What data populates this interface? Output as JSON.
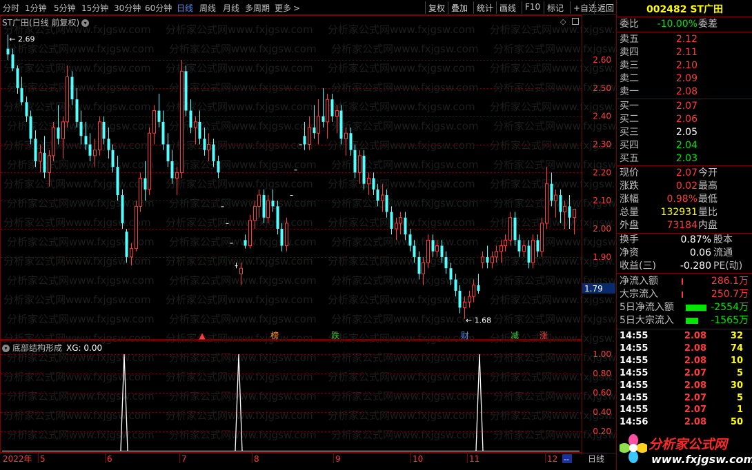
{
  "toolbar": {
    "periods": [
      "分时",
      "1分钟",
      "5分钟",
      "15分钟",
      "30分钟",
      "60分钟",
      "日线",
      "周线",
      "月线",
      "多周期",
      "更多"
    ],
    "active_period": "日线",
    "more_arrow": ">",
    "buttons": [
      "复权",
      "叠加",
      "统计",
      "画线",
      "F10",
      "标记",
      "+自选",
      "返回"
    ]
  },
  "main_chart": {
    "title": "ST广田(日线 前复权)",
    "max_label": "2.69",
    "min_label": "1.68",
    "current_price_tag": "1.79",
    "price_axis": [
      "2.60",
      "2.50",
      "2.40",
      "2.30",
      "2.20",
      "2.10",
      "2.00",
      "1.90"
    ],
    "markers": [
      {
        "label": "▲",
        "color": "#ff3b3b"
      },
      {
        "label": "榜",
        "color": "#ff9933"
      },
      {
        "label": "跌",
        "color": "#33cc33"
      },
      {
        "label": "财",
        "color": "#4f8ff7"
      },
      {
        "label": "减",
        "color": "#33cc33"
      },
      {
        "label": "涨",
        "color": "#ff3b3b"
      }
    ]
  },
  "sub_chart": {
    "title": "底部结构形成",
    "xg_label": "XG: 0.00",
    "axis": [
      "1.00",
      "0.80",
      "0.60",
      "0.40",
      "0.20"
    ],
    "signals": [
      1,
      1,
      1
    ]
  },
  "timeline": {
    "year": "2022年",
    "months": [
      "5",
      "6",
      "7",
      "8",
      "9",
      "10",
      "11",
      "12"
    ],
    "end_marker": "--",
    "period_label": "日线"
  },
  "watermark": "分析家公式网www.fxjgsw.com",
  "quote": {
    "code": "002482",
    "name": "ST广田",
    "weibi_label": "委比",
    "weibi_value": "-10.00%",
    "weicha_label": "委差",
    "asks": [
      {
        "label": "卖五",
        "price": "2.12"
      },
      {
        "label": "卖四",
        "price": "2.11"
      },
      {
        "label": "卖三",
        "price": "2.10"
      },
      {
        "label": "卖二",
        "price": "2.09"
      },
      {
        "label": "卖一",
        "price": "2.08"
      }
    ],
    "bids": [
      {
        "label": "买一",
        "price": "2.07",
        "color": "#ff3b3b"
      },
      {
        "label": "买二",
        "price": "2.06",
        "color": "#ff3b3b"
      },
      {
        "label": "买三",
        "price": "2.05",
        "color": "#ffffff"
      },
      {
        "label": "买四",
        "price": "2.04",
        "color": "#00e600"
      },
      {
        "label": "买五",
        "price": "2.03",
        "color": "#00e600"
      }
    ],
    "stats": [
      {
        "label": "现价",
        "value": "2.07",
        "color": "#ff3b3b",
        "label2": "今开"
      },
      {
        "label": "涨跌",
        "value": "0.02",
        "color": "#ff3b3b",
        "label2": "最高"
      },
      {
        "label": "涨幅",
        "value": "0.98%",
        "color": "#ff3b3b",
        "label2": "最低"
      },
      {
        "label": "总量",
        "value": "132931",
        "color": "#ffff00",
        "label2": "量比"
      },
      {
        "label": "外盘",
        "value": "73184",
        "color": "#ff3b3b",
        "label2": "内盘"
      }
    ],
    "stats2": [
      {
        "label": "换手",
        "value": "0.87%",
        "color": "#ffffff",
        "label2": "股本"
      },
      {
        "label": "净资",
        "value": "0.06",
        "color": "#ffffff",
        "label2": "流通"
      },
      {
        "label": "收益(三)",
        "value": "-0.280",
        "color": "#ffffff",
        "label2": "PE(动)"
      }
    ],
    "flows": [
      {
        "label": "净流入额",
        "value": "286.1万",
        "color": "#ff3b3b",
        "bar": 0.03,
        "bar_color": "#ff3b3b"
      },
      {
        "label": "大宗流入",
        "value": "250.7万",
        "color": "#ff3b3b",
        "bar": 0.03,
        "bar_color": "#ff3b3b"
      },
      {
        "label": "5日净流入额",
        "value": "-2554万",
        "color": "#00e600",
        "bar": 1.0,
        "bar_color": "#00e600"
      },
      {
        "label": "5日大宗流入",
        "value": "-1565万",
        "color": "#00e600",
        "bar": 0.6,
        "bar_color": "#00e600"
      }
    ],
    "ticks": [
      {
        "time": "14:55",
        "price": "2.08",
        "vol": "32"
      },
      {
        "time": "14:55",
        "price": "2.08",
        "vol": "74"
      },
      {
        "time": "14:55",
        "price": "2.08",
        "vol": "10"
      },
      {
        "time": "14:55",
        "price": "2.07",
        "vol": "5"
      },
      {
        "time": "14:55",
        "price": "2.08",
        "vol": "30"
      },
      {
        "time": "14:55",
        "price": "2.07",
        "vol": "5"
      },
      {
        "time": "14:55",
        "price": "2.07",
        "vol": "1"
      },
      {
        "time": "14:56",
        "price": "2.08",
        "vol": "50"
      }
    ]
  },
  "logo": {
    "name": "分析家公式网",
    "url": "www.fxjgsw.com"
  },
  "colors": {
    "up": "#ff3b3b",
    "down": "#54ffff",
    "grid": "#800000",
    "accent": "#4f8ff7"
  },
  "chart_data": {
    "type": "candlestick",
    "title": "ST广田(日线 前复权)",
    "ylim": [
      1.65,
      2.72
    ],
    "ohlc": [
      [
        2.64,
        2.69,
        2.6,
        2.62
      ],
      [
        2.62,
        2.64,
        2.56,
        2.57
      ],
      [
        2.57,
        2.58,
        2.48,
        2.5
      ],
      [
        2.5,
        2.54,
        2.44,
        2.45
      ],
      [
        2.45,
        2.47,
        2.38,
        2.4
      ],
      [
        2.4,
        2.42,
        2.3,
        2.32
      ],
      [
        2.32,
        2.35,
        2.22,
        2.24
      ],
      [
        2.24,
        2.3,
        2.2,
        2.27
      ],
      [
        2.27,
        2.33,
        2.18,
        2.2
      ],
      [
        2.2,
        2.28,
        2.15,
        2.26
      ],
      [
        2.26,
        2.38,
        2.24,
        2.36
      ],
      [
        2.36,
        2.44,
        2.3,
        2.32
      ],
      [
        2.32,
        2.4,
        2.25,
        2.38
      ],
      [
        2.38,
        2.58,
        2.36,
        2.54
      ],
      [
        2.54,
        2.56,
        2.44,
        2.46
      ],
      [
        2.46,
        2.5,
        2.36,
        2.38
      ],
      [
        2.38,
        2.42,
        2.3,
        2.33
      ],
      [
        2.33,
        2.38,
        2.28,
        2.3
      ],
      [
        2.3,
        2.34,
        2.24,
        2.26
      ],
      [
        2.26,
        2.32,
        2.22,
        2.28
      ],
      [
        2.28,
        2.4,
        2.26,
        2.38
      ],
      [
        2.38,
        2.4,
        2.3,
        2.32
      ],
      [
        2.32,
        2.36,
        2.25,
        2.28
      ],
      [
        2.28,
        2.3,
        2.2,
        2.22
      ],
      [
        2.22,
        2.26,
        2.1,
        2.12
      ],
      [
        2.12,
        2.14,
        2.0,
        2.02
      ],
      [
        1.99,
        2.0,
        1.88,
        1.9
      ],
      [
        1.9,
        1.95,
        1.87,
        1.93
      ],
      [
        1.93,
        2.1,
        1.92,
        2.08
      ],
      [
        2.08,
        2.2,
        2.06,
        2.18
      ],
      [
        2.18,
        2.24,
        2.1,
        2.14
      ],
      [
        2.14,
        2.36,
        2.12,
        2.34
      ],
      [
        2.34,
        2.44,
        2.3,
        2.42
      ],
      [
        2.42,
        2.48,
        2.36,
        2.38
      ],
      [
        2.38,
        2.42,
        2.28,
        2.3
      ],
      [
        2.3,
        2.34,
        2.22,
        2.24
      ],
      [
        2.24,
        2.28,
        2.16,
        2.18
      ],
      [
        2.18,
        2.22,
        2.12,
        2.2
      ],
      [
        2.2,
        2.6,
        2.18,
        2.56
      ],
      [
        2.56,
        2.58,
        2.4,
        2.42
      ],
      [
        2.42,
        2.46,
        2.34,
        2.36
      ],
      [
        2.36,
        2.4,
        2.3,
        2.38
      ],
      [
        2.38,
        2.42,
        2.3,
        2.32
      ],
      [
        2.32,
        2.36,
        2.26,
        2.28
      ],
      [
        2.28,
        2.34,
        2.24,
        2.3
      ],
      [
        2.3,
        2.32,
        2.22,
        2.24
      ],
      [
        2.24,
        2.26,
        2.18,
        2.2
      ],
      [
        2.08,
        2.08,
        2.08,
        2.08
      ],
      [
        2.02,
        2.02,
        2.02,
        2.02
      ],
      [
        1.95,
        1.95,
        1.95,
        1.95
      ],
      [
        1.87,
        1.88,
        1.86,
        1.87
      ],
      [
        1.84,
        1.88,
        1.8,
        1.86
      ],
      [
        1.96,
        1.98,
        1.93,
        1.94
      ],
      [
        1.94,
        2.05,
        1.93,
        2.03
      ],
      [
        2.03,
        2.1,
        2.0,
        2.08
      ],
      [
        2.08,
        2.14,
        2.04,
        2.12
      ],
      [
        2.12,
        2.14,
        2.02,
        2.04
      ],
      [
        2.04,
        2.12,
        2.02,
        2.1
      ],
      [
        2.1,
        2.14,
        2.06,
        2.08
      ],
      [
        2.08,
        2.1,
        1.98,
        2.0
      ],
      [
        2.0,
        2.02,
        1.92,
        1.94
      ],
      [
        1.94,
        2.04,
        1.92,
        2.02
      ],
      [
        2.12,
        2.12,
        2.12,
        2.12
      ],
      [
        2.21,
        2.21,
        2.21,
        2.21
      ],
      [
        2.3,
        2.3,
        2.3,
        2.3
      ],
      [
        2.33,
        2.38,
        2.28,
        2.3
      ],
      [
        2.3,
        2.4,
        2.28,
        2.36
      ],
      [
        2.36,
        2.44,
        2.32,
        2.34
      ],
      [
        2.34,
        2.46,
        2.3,
        2.4
      ],
      [
        2.4,
        2.5,
        2.36,
        2.38
      ],
      [
        2.38,
        2.48,
        2.32,
        2.46
      ],
      [
        2.46,
        2.48,
        2.38,
        2.4
      ],
      [
        2.4,
        2.44,
        2.34,
        2.42
      ],
      [
        2.42,
        2.44,
        2.3,
        2.32
      ],
      [
        2.32,
        2.36,
        2.26,
        2.34
      ],
      [
        2.34,
        2.36,
        2.26,
        2.28
      ],
      [
        2.28,
        2.3,
        2.18,
        2.2
      ],
      [
        2.2,
        2.28,
        2.16,
        2.26
      ],
      [
        2.26,
        2.28,
        2.14,
        2.16
      ],
      [
        2.16,
        2.2,
        2.12,
        2.18
      ],
      [
        2.18,
        2.2,
        2.12,
        2.14
      ],
      [
        2.14,
        2.16,
        2.08,
        2.1
      ],
      [
        2.1,
        2.16,
        2.06,
        2.12
      ],
      [
        2.12,
        2.14,
        2.04,
        2.06
      ],
      [
        2.06,
        2.08,
        1.98,
        2.0
      ],
      [
        2.0,
        2.04,
        1.96,
        2.02
      ],
      [
        2.02,
        2.06,
        1.98,
        2.04
      ],
      [
        2.04,
        2.06,
        1.96,
        1.98
      ],
      [
        1.98,
        2.0,
        1.92,
        1.94
      ],
      [
        1.94,
        1.96,
        1.88,
        1.9
      ],
      [
        1.9,
        1.92,
        1.82,
        1.84
      ],
      [
        1.84,
        1.9,
        1.8,
        1.88
      ],
      [
        1.88,
        1.98,
        1.86,
        1.96
      ],
      [
        1.96,
        1.98,
        1.9,
        1.92
      ],
      [
        1.92,
        1.96,
        1.9,
        1.94
      ],
      [
        1.94,
        1.96,
        1.88,
        1.9
      ],
      [
        1.9,
        1.92,
        1.84,
        1.86
      ],
      [
        1.86,
        1.88,
        1.8,
        1.82
      ],
      [
        1.82,
        1.84,
        1.76,
        1.78
      ],
      [
        1.78,
        1.8,
        1.7,
        1.72
      ],
      [
        1.72,
        1.76,
        1.68,
        1.74
      ],
      [
        1.74,
        1.78,
        1.72,
        1.76
      ],
      [
        1.76,
        1.82,
        1.74,
        1.8
      ],
      [
        1.8,
        1.84,
        1.77,
        1.78
      ],
      [
        1.88,
        1.92,
        1.86,
        1.9
      ],
      [
        1.9,
        1.94,
        1.86,
        1.88
      ],
      [
        1.88,
        1.92,
        1.86,
        1.9
      ],
      [
        1.9,
        1.94,
        1.88,
        1.92
      ],
      [
        1.92,
        1.96,
        1.88,
        1.94
      ],
      [
        1.94,
        1.98,
        1.92,
        1.96
      ],
      [
        1.96,
        2.06,
        1.94,
        2.04
      ],
      [
        2.04,
        2.06,
        1.94,
        1.96
      ],
      [
        1.96,
        1.98,
        1.9,
        1.92
      ],
      [
        1.92,
        1.96,
        1.9,
        1.94
      ],
      [
        1.94,
        1.96,
        1.86,
        1.88
      ],
      [
        1.88,
        1.98,
        1.86,
        1.96
      ],
      [
        1.96,
        1.98,
        1.9,
        1.92
      ],
      [
        1.92,
        2.04,
        1.9,
        2.02
      ],
      [
        2.02,
        2.22,
        2.0,
        2.16
      ],
      [
        2.16,
        2.2,
        2.08,
        2.1
      ],
      [
        2.1,
        2.14,
        2.04,
        2.12
      ],
      [
        2.12,
        2.14,
        2.02,
        2.06
      ],
      [
        2.06,
        2.1,
        2.0,
        2.08
      ],
      [
        2.08,
        2.12,
        2.0,
        2.04
      ],
      [
        2.04,
        2.06,
        1.98,
        2.07
      ]
    ],
    "signal_days": [
      1,
      1,
      1
    ],
    "xlabels": [
      "5",
      "6",
      "7",
      "8",
      "9",
      "10",
      "11",
      "12"
    ]
  }
}
